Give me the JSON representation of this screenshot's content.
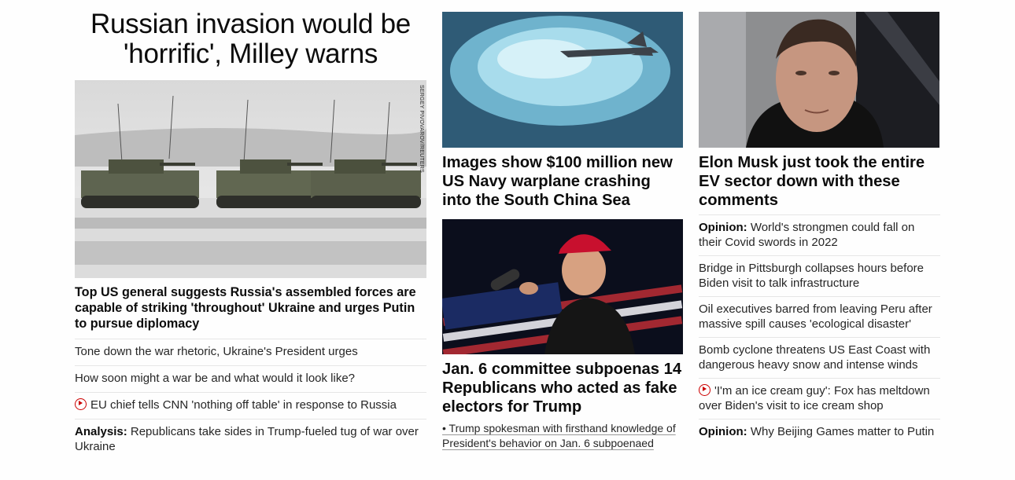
{
  "lead": {
    "headline": "Russian invasion would be 'horrific', Milley warns",
    "image_credit": "SERGEY PIVOVAROV/REUTERS",
    "subhead": "Top US general suggests Russia's assembled forces are capable of striking 'throughout' Ukraine and urges Putin to pursue diplomacy",
    "related": [
      {
        "label": "",
        "text": "Tone down the war rhetoric, Ukraine's President urges",
        "video": false
      },
      {
        "label": "",
        "text": "How soon might a war be and what would it look like?",
        "video": false
      },
      {
        "label": "",
        "text": "EU chief tells CNN 'nothing off table' in response to Russia",
        "video": true
      },
      {
        "label": "Analysis:",
        "text": "Republicans take sides in Trump-fueled tug of war over Ukraine",
        "video": false
      }
    ]
  },
  "middle": {
    "card1": {
      "headline": "Images show $100 million new US Navy warplane crashing into the South China Sea"
    },
    "card2": {
      "headline": "Jan. 6 committee subpoenas 14 Republicans who acted as fake electors for Trump",
      "bullet": "• Trump spokesman with firsthand knowledge of President's behavior on Jan. 6 subpoenaed"
    }
  },
  "right": {
    "card": {
      "headline": "Elon Musk just took the entire EV sector down with these comments"
    },
    "stories": [
      {
        "label": "Opinion:",
        "text": "World's strongmen could fall on their Covid swords in 2022",
        "video": false
      },
      {
        "label": "",
        "text": "Bridge in Pittsburgh collapses hours before Biden visit to talk infrastructure",
        "video": false
      },
      {
        "label": "",
        "text": "Oil executives barred from leaving Peru after massive spill causes 'ecological disaster'",
        "video": false
      },
      {
        "label": "",
        "text": "Bomb cyclone threatens US East Coast with dangerous heavy snow and intense winds",
        "video": false
      },
      {
        "label": "",
        "text": "'I'm an ice cream guy': Fox has meltdown over Biden's visit to ice cream shop",
        "video": true
      },
      {
        "label": "Opinion:",
        "text": "Why Beijing Games matter to Putin",
        "video": false
      }
    ]
  },
  "colors": {
    "text": "#0c0c0c",
    "divider": "#e6e6e6",
    "video_accent": "#cc0000"
  },
  "icons": {
    "video": "play-circle-icon"
  }
}
